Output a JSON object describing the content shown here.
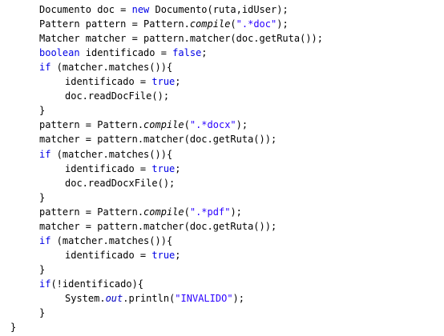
{
  "colors": {
    "background": "#ffffff",
    "plain": "#000000",
    "keyword": "#0000e6",
    "string": "#2a00ff",
    "static_field": "#0000c0"
  },
  "code": {
    "lines": [
      {
        "indent": 1,
        "tokens": [
          {
            "t": "Documento doc = ",
            "k": "plain"
          },
          {
            "t": "new",
            "k": "keyword"
          },
          {
            "t": " Documento(ruta,idUser);",
            "k": "plain"
          }
        ]
      },
      {
        "indent": 1,
        "tokens": [
          {
            "t": "Pattern pattern = Pattern.",
            "k": "plain"
          },
          {
            "t": "compile",
            "k": "italic"
          },
          {
            "t": "(",
            "k": "plain"
          },
          {
            "t": "\".*doc\"",
            "k": "string"
          },
          {
            "t": ");",
            "k": "plain"
          }
        ]
      },
      {
        "indent": 1,
        "tokens": [
          {
            "t": "Matcher matcher = pattern.matcher(doc.getRuta());",
            "k": "plain"
          }
        ]
      },
      {
        "indent": 1,
        "tokens": [
          {
            "t": "boolean",
            "k": "keyword"
          },
          {
            "t": " identificado = ",
            "k": "plain"
          },
          {
            "t": "false",
            "k": "keyword"
          },
          {
            "t": ";",
            "k": "plain"
          }
        ]
      },
      {
        "indent": 1,
        "tokens": [
          {
            "t": "if",
            "k": "keyword"
          },
          {
            "t": " (matcher.matches()){",
            "k": "plain"
          }
        ]
      },
      {
        "indent": 2,
        "tokens": [
          {
            "t": "identificado = ",
            "k": "plain"
          },
          {
            "t": "true",
            "k": "keyword"
          },
          {
            "t": ";",
            "k": "plain"
          }
        ]
      },
      {
        "indent": 2,
        "tokens": [
          {
            "t": "doc.readDocFile();",
            "k": "plain"
          }
        ]
      },
      {
        "indent": 1,
        "tokens": [
          {
            "t": "}",
            "k": "plain"
          }
        ]
      },
      {
        "indent": 1,
        "tokens": [
          {
            "t": "pattern = Pattern.",
            "k": "plain"
          },
          {
            "t": "compile",
            "k": "italic"
          },
          {
            "t": "(",
            "k": "plain"
          },
          {
            "t": "\".*docx\"",
            "k": "string"
          },
          {
            "t": ");",
            "k": "plain"
          }
        ]
      },
      {
        "indent": 1,
        "tokens": [
          {
            "t": "matcher = pattern.matcher(doc.getRuta());",
            "k": "plain"
          }
        ]
      },
      {
        "indent": 1,
        "tokens": [
          {
            "t": "if",
            "k": "keyword"
          },
          {
            "t": " (matcher.matches()){",
            "k": "plain"
          }
        ]
      },
      {
        "indent": 2,
        "tokens": [
          {
            "t": "identificado = ",
            "k": "plain"
          },
          {
            "t": "true",
            "k": "keyword"
          },
          {
            "t": ";",
            "k": "plain"
          }
        ]
      },
      {
        "indent": 2,
        "tokens": [
          {
            "t": "doc.readDocxFile();",
            "k": "plain"
          }
        ]
      },
      {
        "indent": 1,
        "tokens": [
          {
            "t": "}",
            "k": "plain"
          }
        ]
      },
      {
        "indent": 1,
        "tokens": [
          {
            "t": "pattern = Pattern.",
            "k": "plain"
          },
          {
            "t": "compile",
            "k": "italic"
          },
          {
            "t": "(",
            "k": "plain"
          },
          {
            "t": "\".*pdf\"",
            "k": "string"
          },
          {
            "t": ");",
            "k": "plain"
          }
        ]
      },
      {
        "indent": 1,
        "tokens": [
          {
            "t": "matcher = pattern.matcher(doc.getRuta());",
            "k": "plain"
          }
        ]
      },
      {
        "indent": 1,
        "tokens": [
          {
            "t": "if",
            "k": "keyword"
          },
          {
            "t": " (matcher.matches()){",
            "k": "plain"
          }
        ]
      },
      {
        "indent": 2,
        "tokens": [
          {
            "t": "identificado = ",
            "k": "plain"
          },
          {
            "t": "true",
            "k": "keyword"
          },
          {
            "t": ";",
            "k": "plain"
          }
        ]
      },
      {
        "indent": 1,
        "tokens": [
          {
            "t": "}",
            "k": "plain"
          }
        ]
      },
      {
        "indent": 1,
        "tokens": [
          {
            "t": "if",
            "k": "keyword"
          },
          {
            "t": "(!identificado){",
            "k": "plain"
          }
        ]
      },
      {
        "indent": 2,
        "tokens": [
          {
            "t": "System.",
            "k": "plain"
          },
          {
            "t": "out",
            "k": "field"
          },
          {
            "t": ".println(",
            "k": "plain"
          },
          {
            "t": "\"INVALIDO\"",
            "k": "string"
          },
          {
            "t": ");",
            "k": "plain"
          }
        ]
      },
      {
        "indent": 1,
        "tokens": [
          {
            "t": "}",
            "k": "plain"
          }
        ]
      },
      {
        "indent": 0,
        "tokens": [
          {
            "t": "}",
            "k": "plain"
          }
        ]
      }
    ]
  }
}
